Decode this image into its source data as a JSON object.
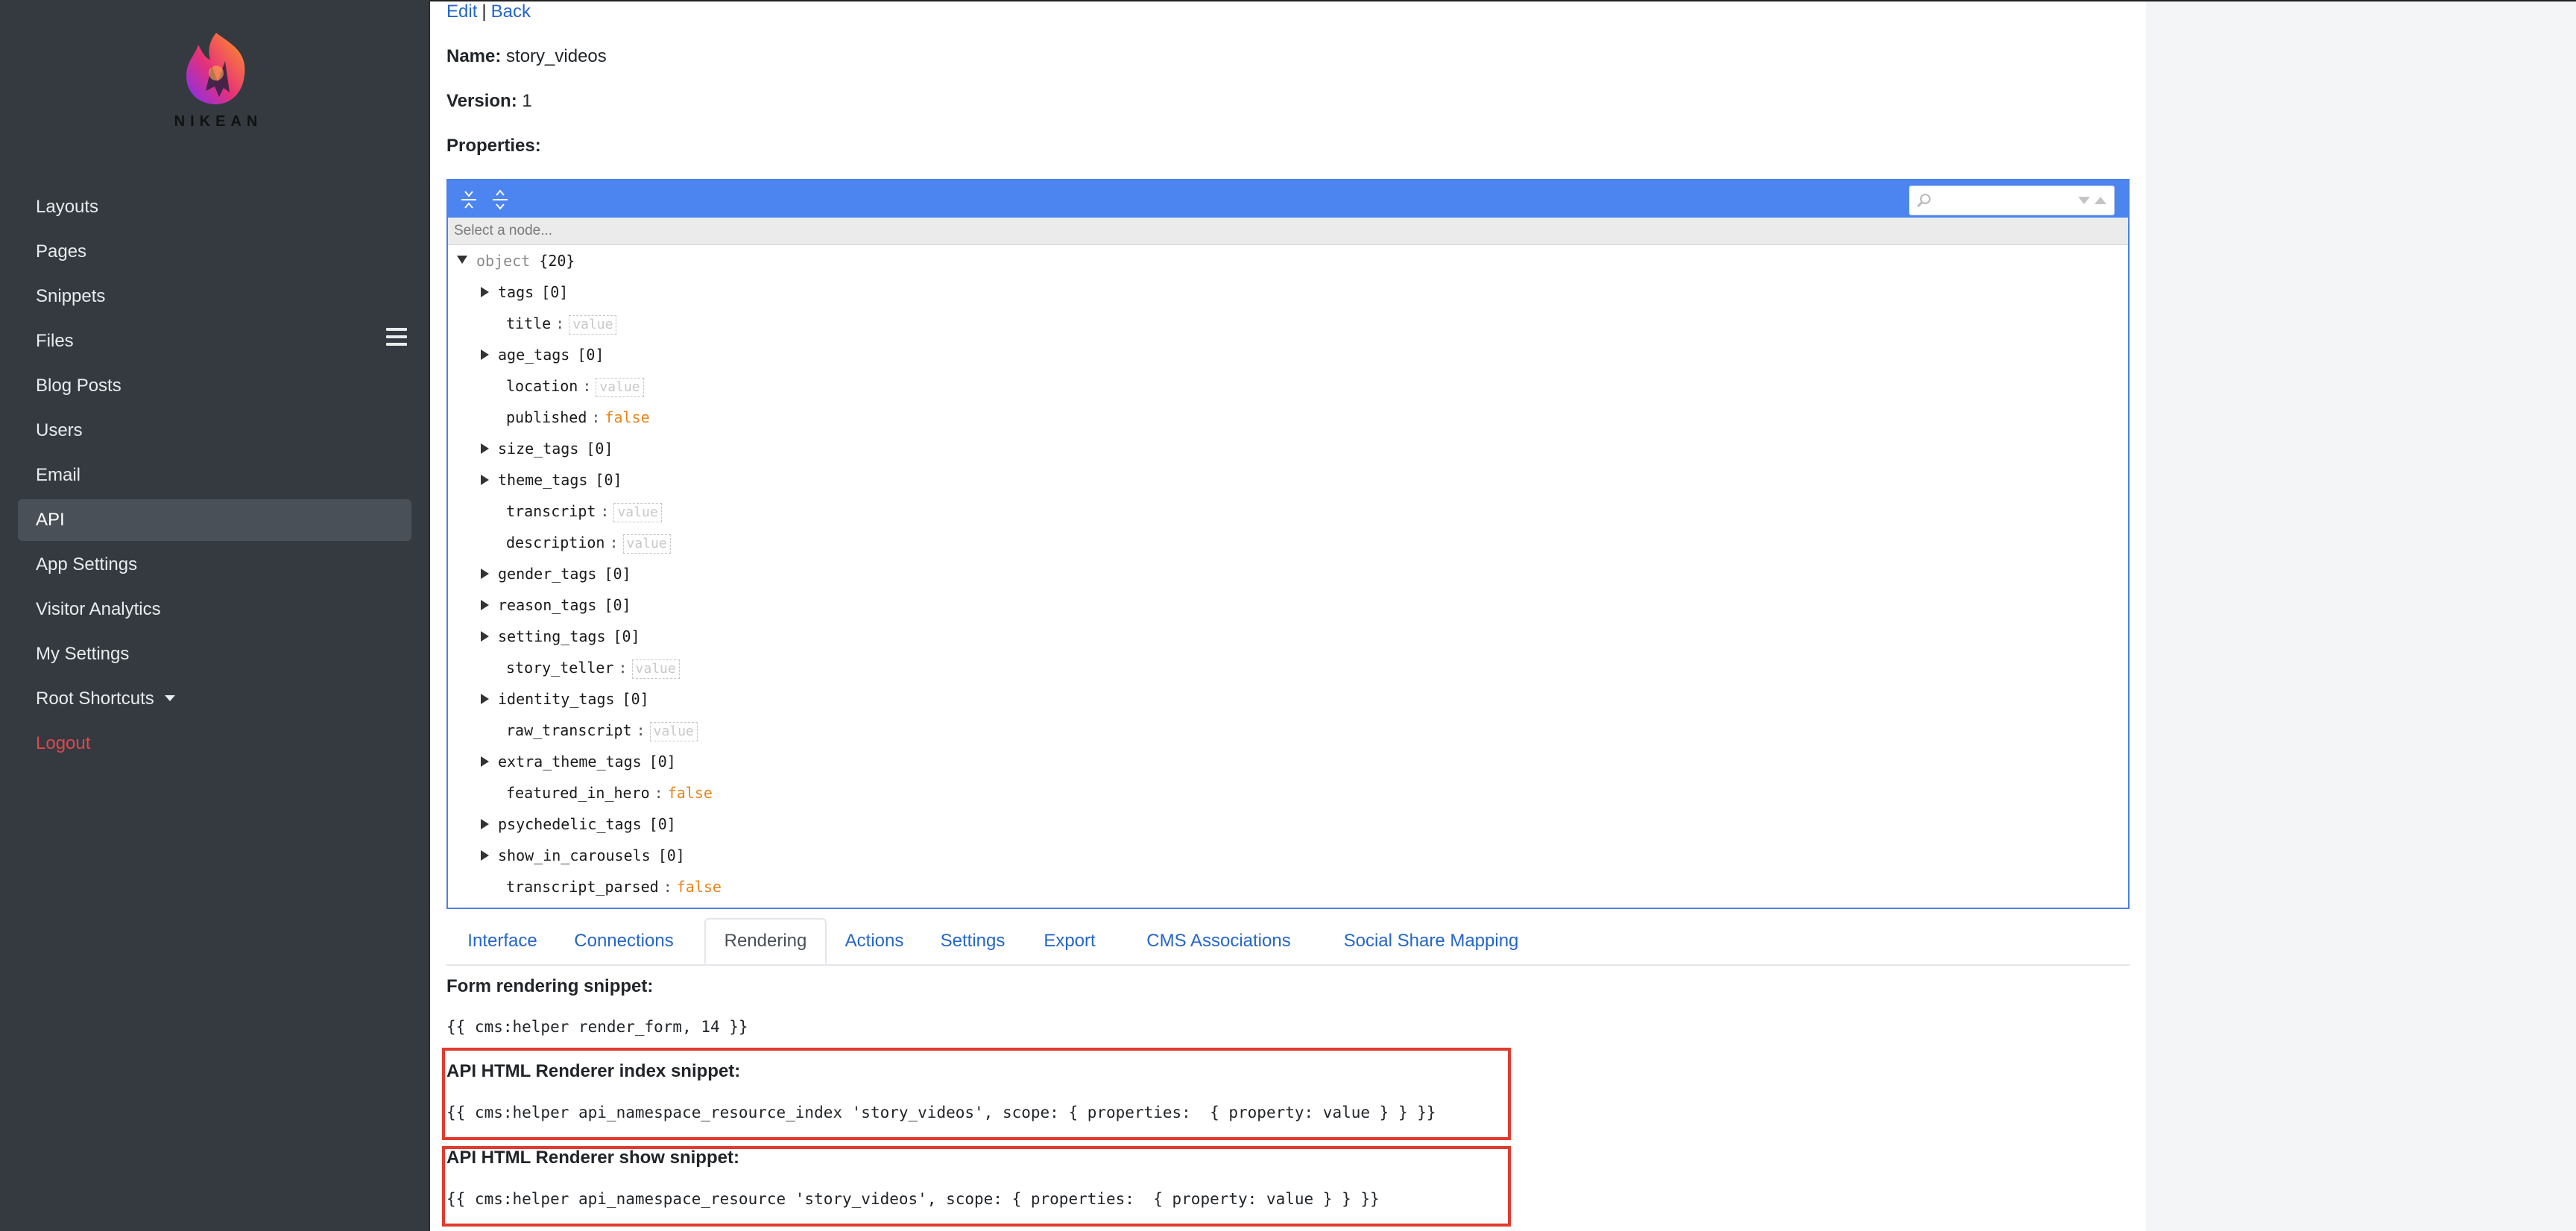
{
  "logo": {
    "text": "NIKEAN"
  },
  "nav": {
    "items": [
      {
        "label": "Layouts"
      },
      {
        "label": "Pages"
      },
      {
        "label": "Snippets"
      },
      {
        "label": "Files"
      },
      {
        "label": "Blog Posts"
      },
      {
        "label": "Users"
      },
      {
        "label": "Email"
      },
      {
        "label": "API",
        "active": true
      },
      {
        "label": "App Settings"
      },
      {
        "label": "Visitor Analytics"
      },
      {
        "label": "My Settings"
      },
      {
        "label": "Root Shortcuts",
        "dropdown": true
      },
      {
        "label": "Logout",
        "danger": true
      }
    ]
  },
  "breadcrumb": {
    "edit": "Edit",
    "separator": "|",
    "back": "Back"
  },
  "details": {
    "name_label": "Name:",
    "name_value": "story_videos",
    "version_label": "Version:",
    "version_value": "1",
    "properties_label": "Properties:"
  },
  "editor": {
    "navbar_placeholder": "Select a node...",
    "search_value": "",
    "root": {
      "key": "object",
      "count": "{20}"
    },
    "nodes": [
      {
        "key": "tags",
        "count": "[0]",
        "type": "array"
      },
      {
        "key": "title",
        "type": "empty",
        "value": "value"
      },
      {
        "key": "age_tags",
        "count": "[0]",
        "type": "array"
      },
      {
        "key": "location",
        "type": "empty",
        "value": "value"
      },
      {
        "key": "published",
        "type": "bool",
        "value": "false"
      },
      {
        "key": "size_tags",
        "count": "[0]",
        "type": "array"
      },
      {
        "key": "theme_tags",
        "count": "[0]",
        "type": "array"
      },
      {
        "key": "transcript",
        "type": "empty",
        "value": "value"
      },
      {
        "key": "description",
        "type": "empty",
        "value": "value"
      },
      {
        "key": "gender_tags",
        "count": "[0]",
        "type": "array"
      },
      {
        "key": "reason_tags",
        "count": "[0]",
        "type": "array"
      },
      {
        "key": "setting_tags",
        "count": "[0]",
        "type": "array"
      },
      {
        "key": "story_teller",
        "type": "empty",
        "value": "value"
      },
      {
        "key": "identity_tags",
        "count": "[0]",
        "type": "array"
      },
      {
        "key": "raw_transcript",
        "type": "empty",
        "value": "value"
      },
      {
        "key": "extra_theme_tags",
        "count": "[0]",
        "type": "array"
      },
      {
        "key": "featured_in_hero",
        "type": "bool",
        "value": "false"
      },
      {
        "key": "psychedelic_tags",
        "count": "[0]",
        "type": "array"
      },
      {
        "key": "show_in_carousels",
        "count": "[0]",
        "type": "array"
      },
      {
        "key": "transcript_parsed",
        "type": "bool",
        "value": "false"
      }
    ]
  },
  "tabs": [
    {
      "label": "Interface"
    },
    {
      "label": "Connections"
    },
    {
      "label": "Rendering",
      "active": true
    },
    {
      "label": "Actions"
    },
    {
      "label": "Settings"
    },
    {
      "label": "Export"
    },
    {
      "label": "CMS Associations"
    },
    {
      "label": "Social Share Mapping"
    }
  ],
  "rendering": {
    "form_label": "Form rendering snippet:",
    "form_code": "{{ cms:helper render_form, 14 }}",
    "index_label": "API HTML Renderer index snippet:",
    "index_code": "{{ cms:helper api_namespace_resource_index 'story_videos', scope: { properties:  { property: value } } }}",
    "show_label": "API HTML Renderer show snippet:",
    "show_code": "{{ cms:helper api_namespace_resource 'story_videos', scope: { properties:  { property: value } } }}"
  },
  "colors": {
    "accent": "#4c84f0",
    "highlight": "#e23b2e",
    "sidebar": "#343a40",
    "link": "#2566c9"
  }
}
